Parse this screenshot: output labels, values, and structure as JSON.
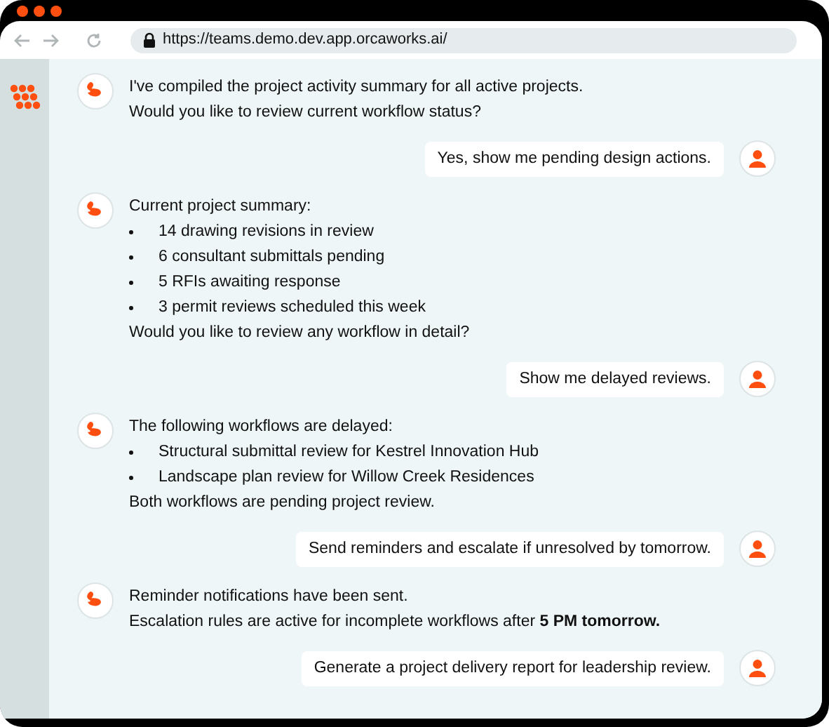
{
  "browser": {
    "url": "https://teams.demo.dev.app.orcaworks.ai/"
  },
  "messages": [
    {
      "kind": "bot",
      "lines": [
        {
          "kind": "text",
          "text": "I've compiled the project activity summary for all active projects."
        },
        {
          "kind": "text",
          "text": "Would you like to review current workflow status?"
        }
      ]
    },
    {
      "kind": "user",
      "text": "Yes, show me pending design actions."
    },
    {
      "kind": "bot",
      "lines": [
        {
          "kind": "text",
          "text": "Current project summary:"
        },
        {
          "kind": "bullet",
          "text": "14 drawing revisions in review"
        },
        {
          "kind": "bullet",
          "text": "6 consultant submittals pending"
        },
        {
          "kind": "bullet",
          "text": "5 RFIs awaiting response"
        },
        {
          "kind": "bullet",
          "text": "3 permit reviews scheduled this week"
        },
        {
          "kind": "text",
          "text": "Would you like to review any workflow in detail?"
        }
      ]
    },
    {
      "kind": "user",
      "text": "Show me delayed reviews."
    },
    {
      "kind": "bot",
      "lines": [
        {
          "kind": "text",
          "text": "The following workflows are delayed:"
        },
        {
          "kind": "bullet",
          "text": "Structural submittal review for Kestrel Innovation Hub"
        },
        {
          "kind": "bullet",
          "text": "Landscape plan review for Willow Creek Residences"
        },
        {
          "kind": "text",
          "text": "Both workflows are pending project review."
        }
      ]
    },
    {
      "kind": "user",
      "text": "Send reminders and escalate if unresolved by tomorrow."
    },
    {
      "kind": "bot",
      "lines": [
        {
          "kind": "text",
          "text": "Reminder notifications have been sent."
        },
        {
          "kind": "text",
          "text": "Escalation rules are active for incomplete workflows after **5 PM tomorrow.**"
        }
      ]
    },
    {
      "kind": "user",
      "text": "Generate a project delivery report for leadership review."
    }
  ]
}
